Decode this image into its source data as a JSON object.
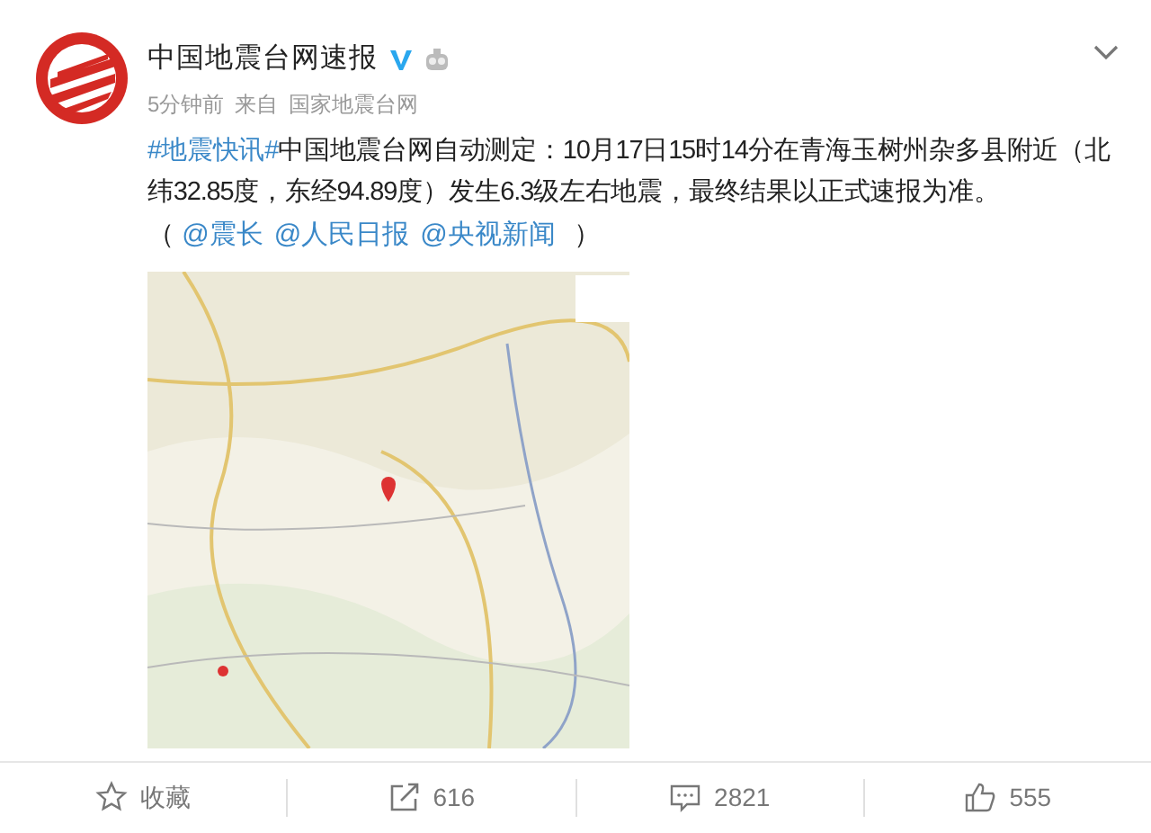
{
  "post": {
    "author": "中国地震台网速报",
    "verified": true,
    "time": "5分钟前",
    "source_label": "来自",
    "source": "国家地震台网",
    "body": [
      {
        "kind": "link",
        "text": "#地震快讯#"
      },
      {
        "kind": "text",
        "text": "中国地震台网自动测定：10月17日15时14分在青海玉树州杂多县附近（北纬32.85度，东经94.89度）发生6.3级左右地震，最终结果以正式速报为准。"
      }
    ],
    "mentions": [
      {
        "kind": "text",
        "text": "（ "
      },
      {
        "kind": "link",
        "text": "@震长"
      },
      {
        "kind": "link",
        "text": "@人民日报"
      },
      {
        "kind": "link",
        "text": "@央视新闻"
      },
      {
        "kind": "text",
        "text": " ）"
      }
    ]
  },
  "actions": [
    {
      "kind": "favorite",
      "label": "收藏"
    },
    {
      "kind": "repost",
      "label": "616"
    },
    {
      "kind": "comment",
      "label": "2821"
    },
    {
      "kind": "like",
      "label": "555"
    }
  ]
}
